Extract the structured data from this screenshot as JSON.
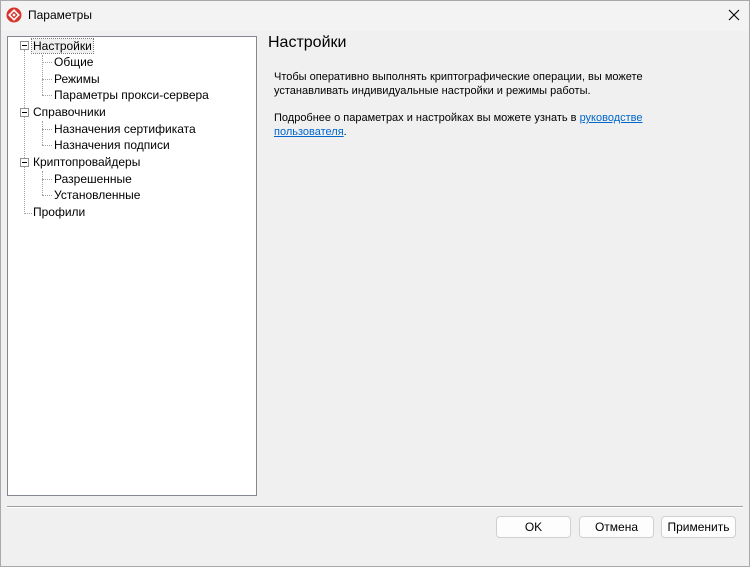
{
  "window": {
    "title": "Параметры",
    "icon": "cryptopro-logo-icon",
    "close_icon": "close-icon"
  },
  "tree": {
    "items": [
      {
        "label": "Настройки",
        "level": 0,
        "expanded": true,
        "selected": true
      },
      {
        "label": "Общие",
        "level": 1
      },
      {
        "label": "Режимы",
        "level": 1
      },
      {
        "label": "Параметры прокси-сервера",
        "level": 1
      },
      {
        "label": "Справочники",
        "level": 0,
        "expanded": true
      },
      {
        "label": "Назначения сертификата",
        "level": 1
      },
      {
        "label": "Назначения подписи",
        "level": 1
      },
      {
        "label": "Криптопровайдеры",
        "level": 0,
        "expanded": true
      },
      {
        "label": "Разрешенные",
        "level": 1
      },
      {
        "label": "Установленные",
        "level": 1
      },
      {
        "label": "Профили",
        "level": 0
      }
    ]
  },
  "content": {
    "title": "Настройки",
    "paragraph1": "Чтобы оперативно выполнять криптографические операции, вы можете устанавливать индивидуальные настройки и режимы работы.",
    "paragraph2_prefix": "Подробнее о параметрах и настройках вы можете узнать в ",
    "paragraph2_link_line1": "руководстве",
    "paragraph2_link_line2": "пользователя",
    "paragraph2_suffix": "."
  },
  "buttons": {
    "ok": "OK",
    "cancel": "Отмена",
    "apply": "Применить"
  },
  "colors": {
    "link": "#0066cc",
    "logo": "#d9342b"
  }
}
